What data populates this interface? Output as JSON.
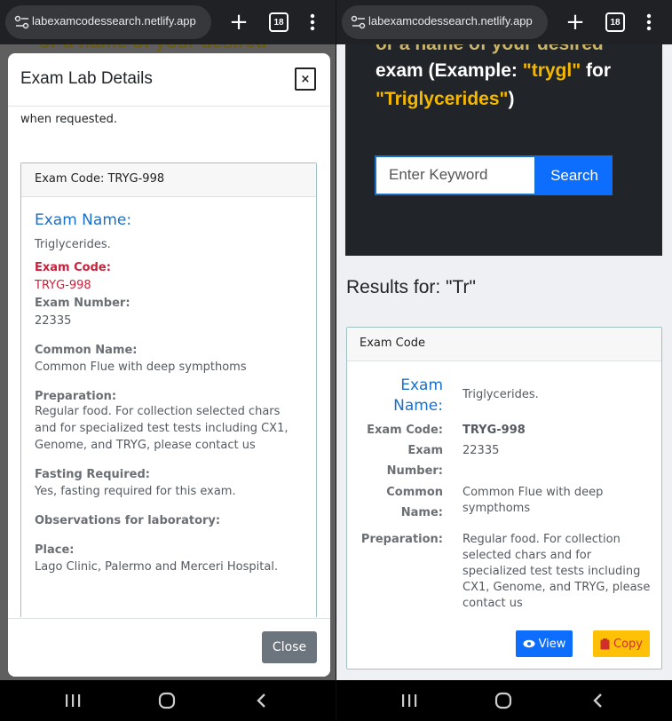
{
  "browser": {
    "url": "labexamcodessearch.netlify.app",
    "tab_count": "18"
  },
  "left": {
    "background_snippet": "or a name of your desired",
    "modal": {
      "title": "Exam Lab Details",
      "close_x": "×",
      "intro_tail": "when requested.",
      "card_header": "Exam Code: TRYG-998",
      "exam_name_title": "Exam Name:",
      "exam_name_value": "Triglycerides.",
      "exam_code_label": "Exam Code:",
      "exam_code_value": "TRYG-998",
      "exam_number_label": "Exam Number:",
      "exam_number_value": "22335",
      "common_name_label": "Common Name:",
      "common_name_value": "Common Flue with deep sympthoms",
      "preparation_label": "Preparation:",
      "preparation_value": "Regular food. For collection selected chars and for specialized test tests including CX1, Genome, and TRYG, please contact us",
      "fasting_label": "Fasting Required:",
      "fasting_value": "Yes, fasting required for this exam.",
      "observations_label": "Observations for laboratory:",
      "place_label": "Place:",
      "place_value": "Lago Clinic, Palermo and Merceri Hospital.",
      "close_button": "Close"
    }
  },
  "right": {
    "hero": {
      "line0": "or a name of your desired",
      "line1_pre": "exam (Example: ",
      "line1_hl": "\"trygl\"",
      "line1_post": " for",
      "line2_hl": "\"Triglycerides\"",
      "line2_post": ")"
    },
    "search": {
      "placeholder": "Enter Keyword",
      "button": "Search"
    },
    "results_title": "Results for: \"Tr\"",
    "card": {
      "header": "Exam Code",
      "name_label_1": "Exam",
      "name_label_2": "Name:",
      "name_value": "Triglycerides.",
      "code_label": "Exam Code:",
      "code_value": "TRYG-998",
      "number_label_1": "Exam",
      "number_label_2": "Number:",
      "number_value": "22335",
      "common_label_1": "Common",
      "common_label_2": "Name:",
      "common_value": "Common Flue with deep sympthoms",
      "prep_label": "Preparation:",
      "prep_value": "Regular food. For collection selected chars and for specialized test tests including CX1, Genome, and TRYG, please contact us",
      "view_button": "View",
      "copy_button": "Copy"
    }
  }
}
